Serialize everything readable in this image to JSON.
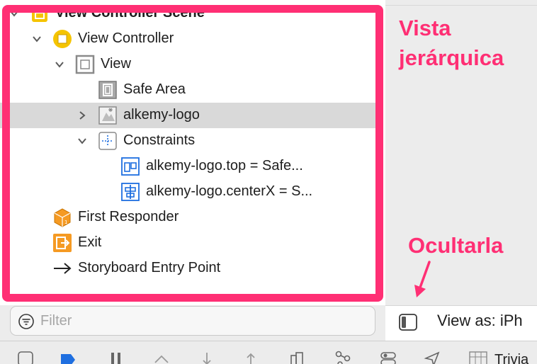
{
  "outline": {
    "rows": [
      {
        "label": "View Controller Scene",
        "icon": "scene-icon",
        "indent": 0,
        "expanded": true,
        "bold": true
      },
      {
        "label": "View Controller",
        "icon": "view-controller-icon",
        "indent": 1,
        "expanded": true,
        "bold": false
      },
      {
        "label": "View",
        "icon": "view-icon",
        "indent": 2,
        "expanded": true,
        "bold": false
      },
      {
        "label": "Safe Area",
        "icon": "safe-area-icon",
        "indent": 3,
        "expanded": null,
        "bold": false
      },
      {
        "label": "alkemy-logo",
        "icon": "image-view-icon",
        "indent": 3,
        "expanded": false,
        "bold": false,
        "selected": true
      },
      {
        "label": "Constraints",
        "icon": "constraints-icon",
        "indent": 3,
        "expanded": true,
        "bold": false
      },
      {
        "label": "alkemy-logo.top = Safe...",
        "icon": "top-constraint-icon",
        "indent": 4,
        "expanded": null,
        "bold": false
      },
      {
        "label": "alkemy-logo.centerX = S...",
        "icon": "centerx-constraint-icon",
        "indent": 4,
        "expanded": null,
        "bold": false
      },
      {
        "label": "First Responder",
        "icon": "first-responder-icon",
        "indent": 1,
        "expanded": null,
        "bold": false
      },
      {
        "label": "Exit",
        "icon": "exit-icon",
        "indent": 1,
        "expanded": null,
        "bold": false
      },
      {
        "label": "Storyboard Entry Point",
        "icon": "entry-arrow-icon",
        "indent": 1,
        "expanded": null,
        "bold": false
      }
    ]
  },
  "filter": {
    "placeholder": "Filter"
  },
  "device_bar": {
    "view_as": "View as: iPh"
  },
  "annotations": {
    "title_line1": "Vista",
    "title_line2": "jerárquica",
    "hide": "Ocultarla"
  },
  "toolbar": {
    "trivia": "Trivia"
  },
  "colors": {
    "highlight": "#ff2f74",
    "selected_row": "#d9d9d9",
    "accent_blue": "#1f6fe0",
    "orange": "#f59a23",
    "yellow": "#f5c400"
  }
}
